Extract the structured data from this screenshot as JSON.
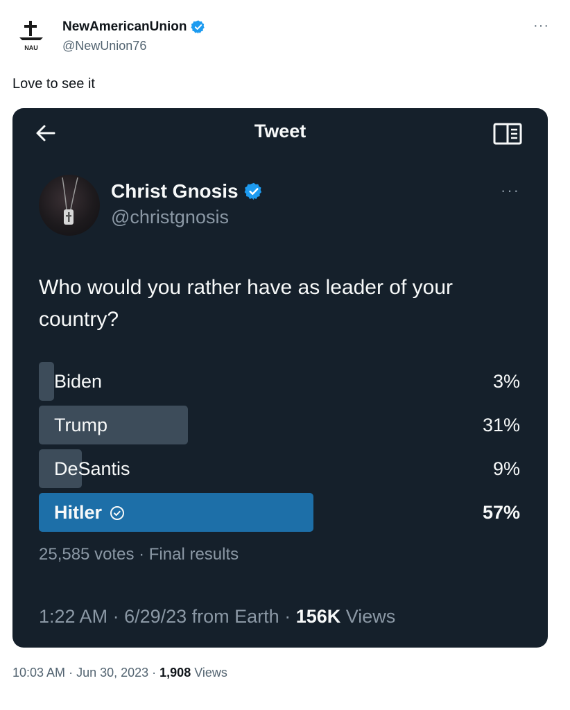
{
  "outer": {
    "author_name": "NewAmericanUnion",
    "author_handle": "@NewUnion76",
    "logo_text": "NAU",
    "more_label": "···",
    "text": "Love to see it",
    "footer_time": "10:03 AM",
    "footer_sep1": " · ",
    "footer_date": "Jun 30, 2023",
    "footer_sep2": " · ",
    "footer_views_count": "1,908",
    "footer_views_label": " Views"
  },
  "embed": {
    "title": "Tweet",
    "author_name": "Christ Gnosis",
    "author_handle": "@christgnosis",
    "more_label": "···",
    "question": "Who would you rather have as leader of your country?",
    "poll": {
      "options": [
        {
          "label": "Biden",
          "percent_text": "3%",
          "share": 0.03,
          "winner": false
        },
        {
          "label": "Trump",
          "percent_text": "31%",
          "share": 0.31,
          "winner": false
        },
        {
          "label": "DeSantis",
          "percent_text": "9%",
          "share": 0.09,
          "winner": false
        },
        {
          "label": "Hitler",
          "percent_text": "57%",
          "share": 0.57,
          "winner": true
        }
      ],
      "meta": "25,585 votes · Final results"
    },
    "footer_time": "1:22 AM",
    "footer_sep1": " · ",
    "footer_date": "6/29/23 from Earth",
    "footer_sep2": " · ",
    "footer_views_count": "156K",
    "footer_views_label": " Views"
  },
  "colors": {
    "embed_bg": "#15202b",
    "bar": "#3d4c5a",
    "winner_bar": "#1d6fa8",
    "verified": "#1d9bf0"
  },
  "icons": {
    "back": "back-arrow-icon",
    "reader": "reader-mode-icon",
    "verified": "verified-badge-icon",
    "check": "check-circle-icon"
  }
}
